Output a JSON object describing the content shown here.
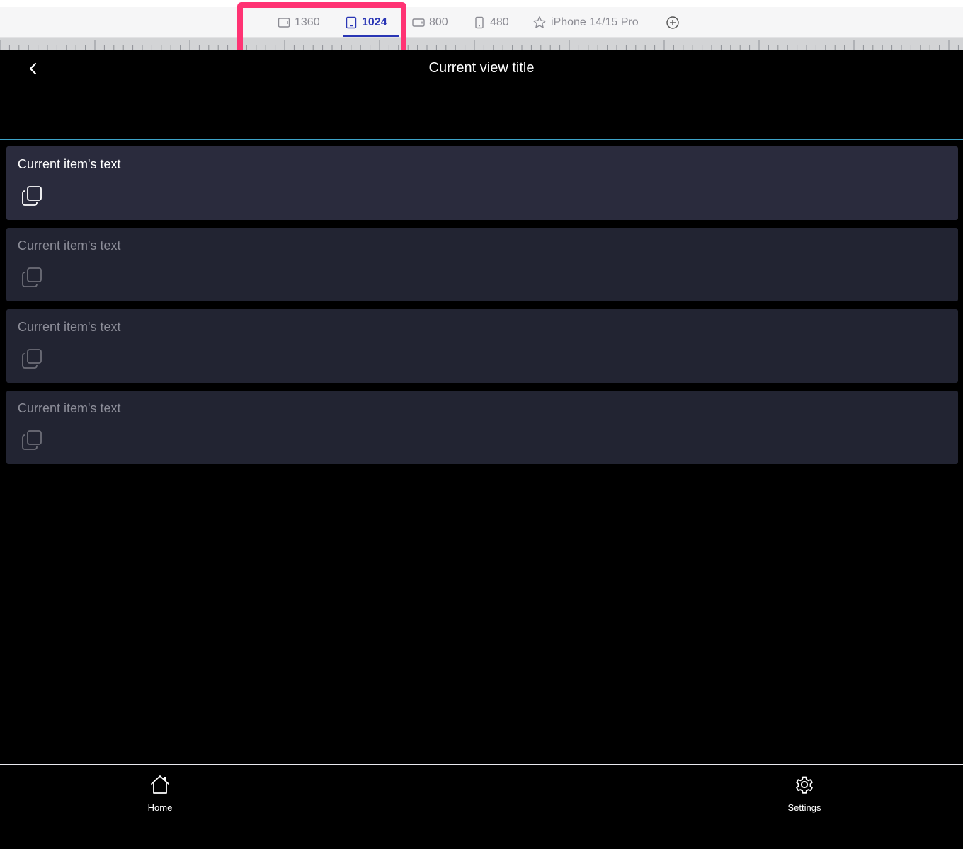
{
  "breakpoint_bar": {
    "items": [
      {
        "label": "1360",
        "icon": "monitor-icon"
      },
      {
        "label": "1024",
        "icon": "tablet-icon",
        "active": true
      },
      {
        "label": "800",
        "icon": "tablet-landscape-icon"
      },
      {
        "label": "480",
        "icon": "phone-icon"
      },
      {
        "label": "iPhone 14/15 Pro",
        "icon": "star-icon"
      }
    ],
    "add_icon": "plus-circle-icon",
    "active_color": "#2a36b5",
    "highlight_color": "#ff3374"
  },
  "header": {
    "title": "Current view title",
    "back_icon": "chevron-left-icon",
    "accent_line_color": "#3ea4c8"
  },
  "list": {
    "items": [
      {
        "text": "Current item's text",
        "selected": true,
        "icon": "copy-icon"
      },
      {
        "text": "Current item's text",
        "selected": false,
        "icon": "copy-icon"
      },
      {
        "text": "Current item's text",
        "selected": false,
        "icon": "copy-icon"
      },
      {
        "text": "Current item's text",
        "selected": false,
        "icon": "copy-icon"
      }
    ]
  },
  "bottom_nav": {
    "home_label": "Home",
    "settings_label": "Settings",
    "home_icon": "home-icon",
    "settings_icon": "gear-icon"
  }
}
